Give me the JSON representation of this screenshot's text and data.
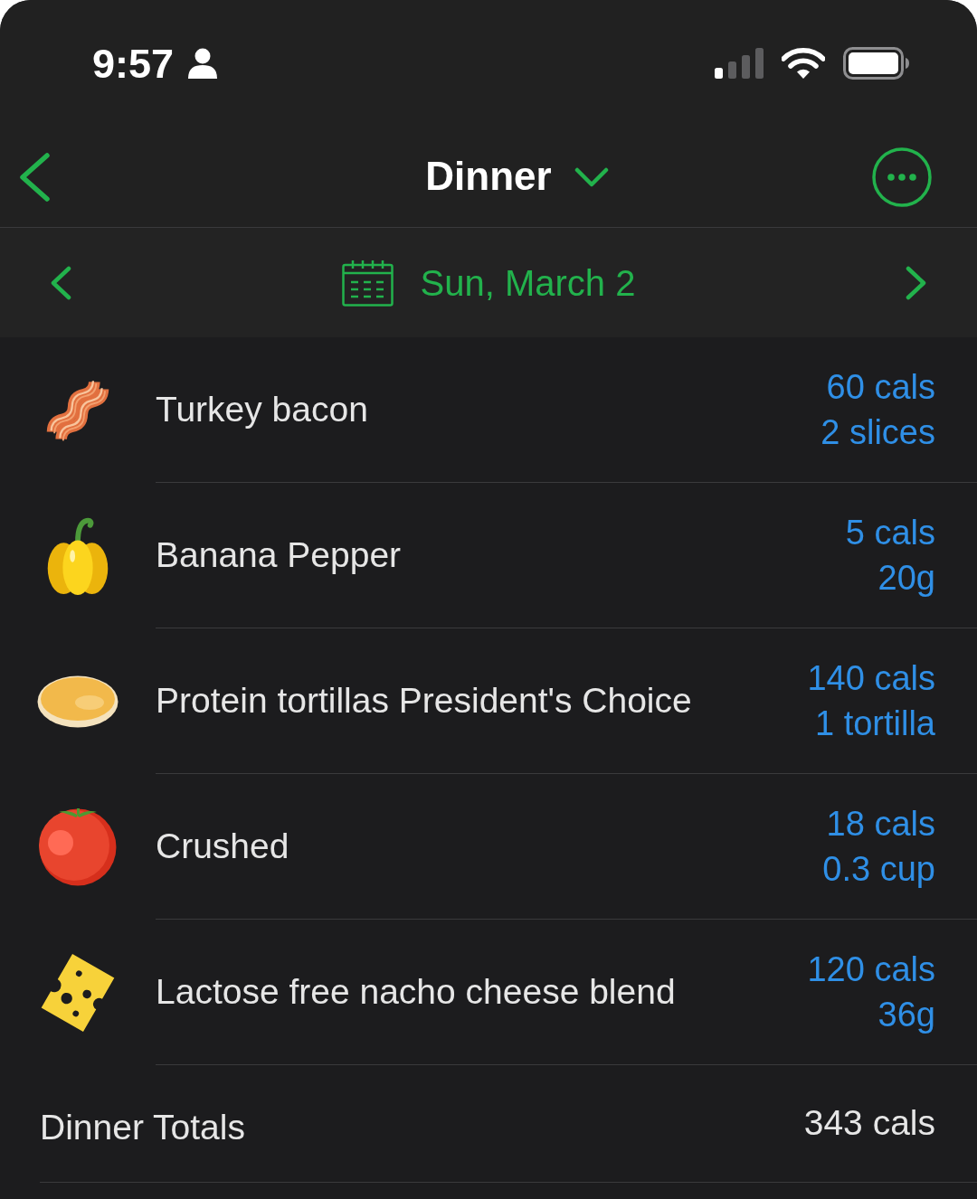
{
  "status_bar": {
    "time": "9:57"
  },
  "header": {
    "title": "Dinner"
  },
  "date_bar": {
    "date": "Sun, March 2"
  },
  "foods": [
    {
      "kind": "bacon",
      "name": "Turkey bacon",
      "calories": "60 cals",
      "serving": "2 slices"
    },
    {
      "kind": "pepper",
      "name": "Banana Pepper",
      "calories": "5 cals",
      "serving": "20g"
    },
    {
      "kind": "tortilla",
      "name": "Protein tortillas President's Choice",
      "calories": "140 cals",
      "serving": "1 tortilla"
    },
    {
      "kind": "tomato",
      "name": "Crushed",
      "calories": "18 cals",
      "serving": "0.3 cup"
    },
    {
      "kind": "cheese",
      "name": "Lactose free nacho cheese blend",
      "calories": "120 cals",
      "serving": "36g"
    }
  ],
  "totals": {
    "label": "Dinner Totals",
    "calories": "343 cals"
  }
}
